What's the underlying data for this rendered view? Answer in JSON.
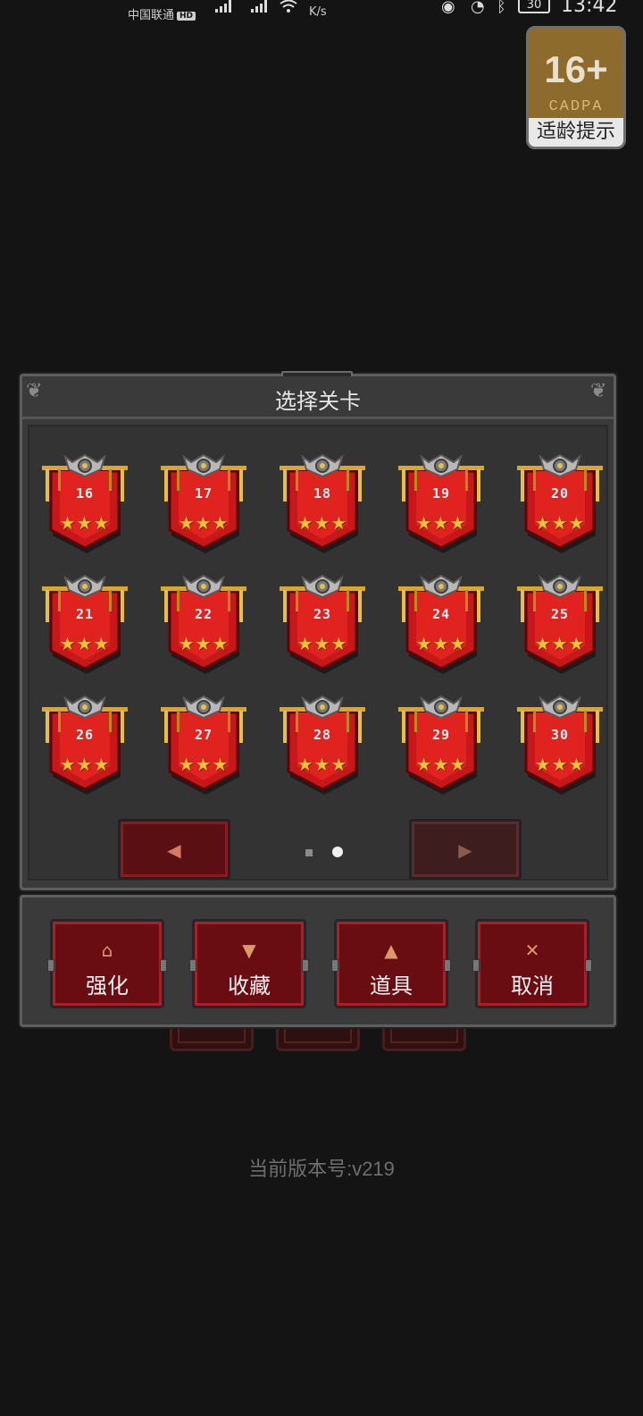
{
  "status_bar": {
    "carrier": "中国联通",
    "carrier_badge": "HD",
    "net_speed": "K/s",
    "battery": "30",
    "time": "13:42",
    "icons": [
      "signal-icon",
      "signal-icon",
      "wifi-icon",
      "eye-icon",
      "alarm-icon",
      "bluetooth-icon",
      "battery-icon"
    ]
  },
  "age_rating": {
    "number": "16+",
    "org": "CADPA",
    "label": "适龄提示"
  },
  "dialog": {
    "title": "选择关卡",
    "levels": [
      {
        "number": "16",
        "stars": "★★★"
      },
      {
        "number": "17",
        "stars": "★★★"
      },
      {
        "number": "18",
        "stars": "★★★"
      },
      {
        "number": "19",
        "stars": "★★★"
      },
      {
        "number": "20",
        "stars": "★★★"
      },
      {
        "number": "21",
        "stars": "★★★"
      },
      {
        "number": "22",
        "stars": "★★★"
      },
      {
        "number": "23",
        "stars": "★★★"
      },
      {
        "number": "24",
        "stars": "★★★"
      },
      {
        "number": "25",
        "stars": "★★★"
      },
      {
        "number": "26",
        "stars": "★★★"
      },
      {
        "number": "27",
        "stars": "★★★"
      },
      {
        "number": "28",
        "stars": "★★★"
      },
      {
        "number": "29",
        "stars": "★★★"
      },
      {
        "number": "30",
        "stars": "★★★"
      }
    ],
    "prev_arrow": "◀",
    "next_arrow": "▶",
    "pagination": {
      "current": 2,
      "total": 2
    }
  },
  "actions": [
    {
      "icon": "upgrade-icon",
      "glyph": "⌂",
      "label": "强化"
    },
    {
      "icon": "trophy-icon",
      "glyph": "▼",
      "label": "收藏"
    },
    {
      "icon": "potion-icon",
      "glyph": "▲",
      "label": "道具"
    },
    {
      "icon": "close-icon",
      "glyph": "✕",
      "label": "取消"
    }
  ],
  "version": "当前版本号:v219",
  "colors": {
    "background": "#141414",
    "panel": "#3a3a3a",
    "banner_red": "#c8171b",
    "star_gold": "#f2c233",
    "button_red": "#6a0d12"
  }
}
